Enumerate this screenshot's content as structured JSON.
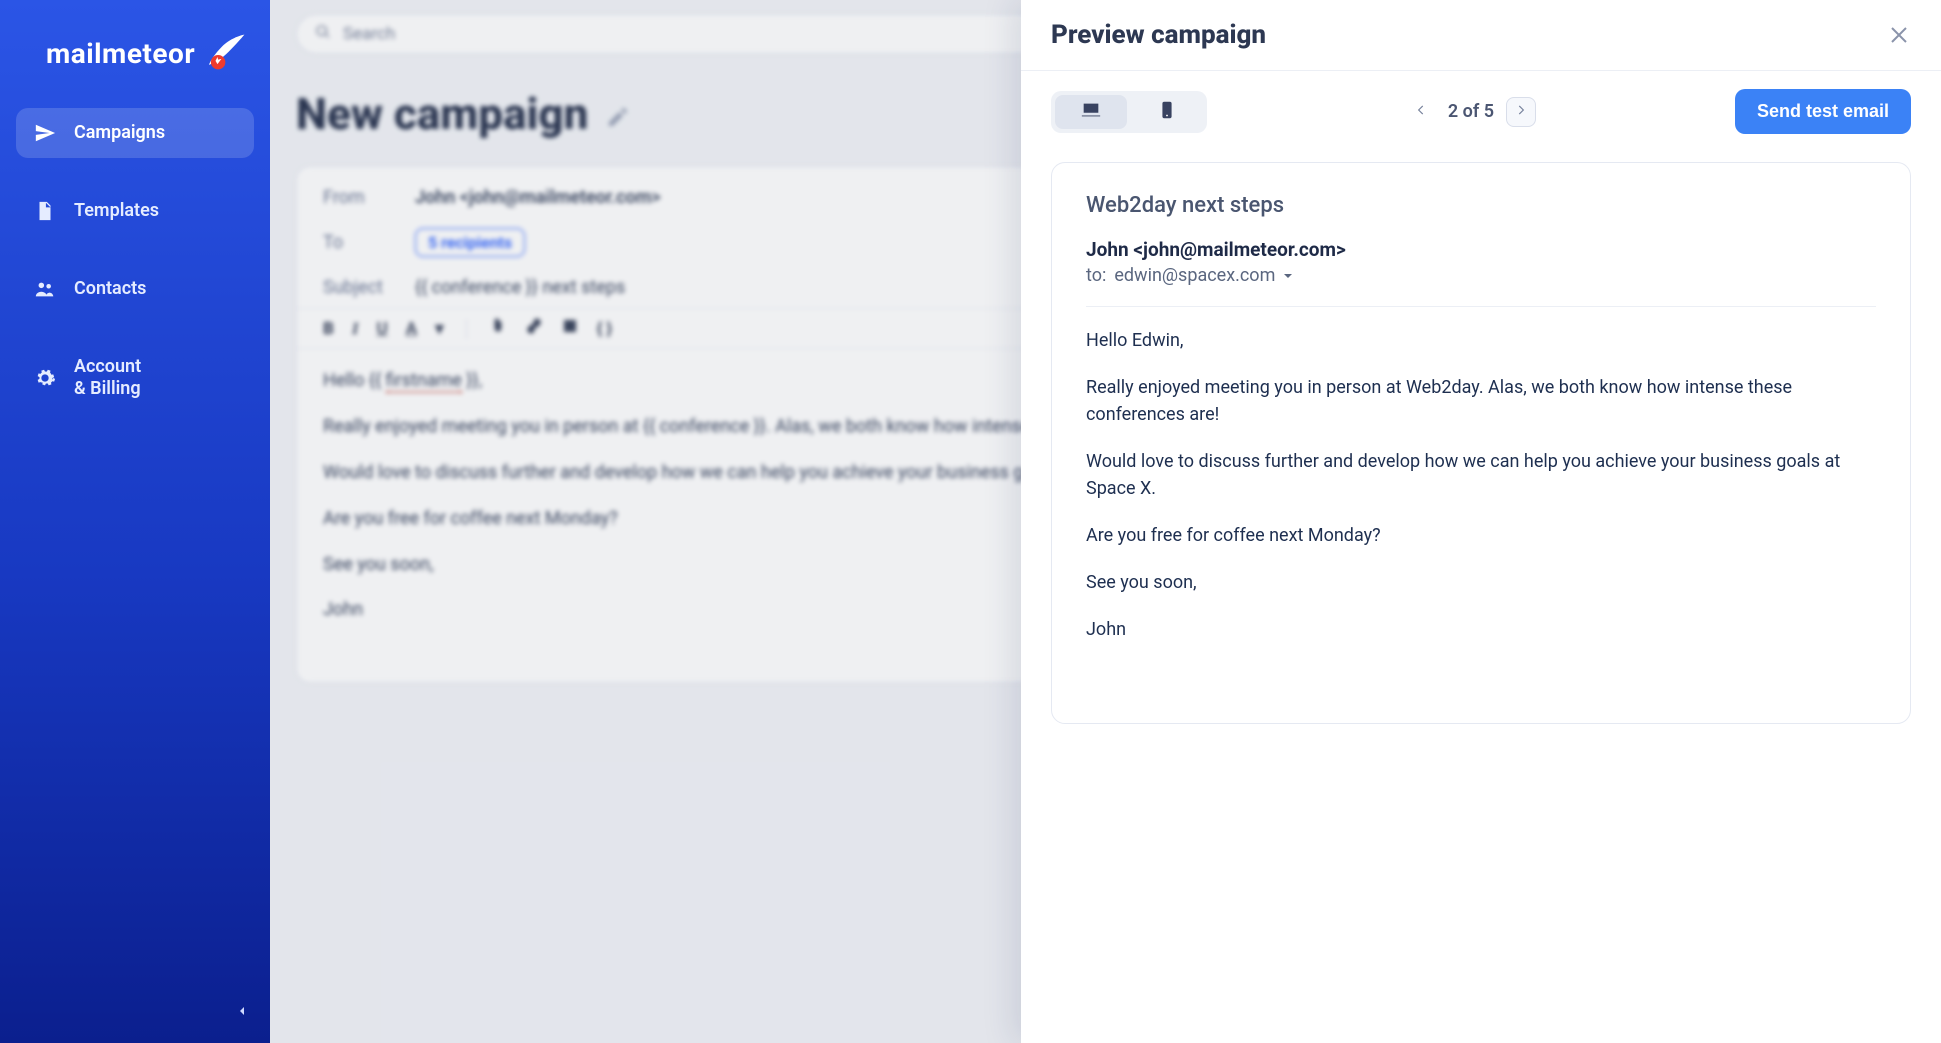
{
  "brand": {
    "name": "mailmeteor"
  },
  "search": {
    "placeholder": "Search"
  },
  "sidebar": {
    "items": [
      {
        "label": "Campaigns",
        "icon": "send-icon",
        "active": true
      },
      {
        "label": "Templates",
        "icon": "file-icon"
      },
      {
        "label": "Contacts",
        "icon": "people-icon"
      },
      {
        "label": "Account\n& Billing",
        "icon": "gear-icon"
      }
    ]
  },
  "composer": {
    "page_title": "New campaign",
    "from_label": "From",
    "from_value": "John <john@mailmeteor.com>",
    "to_label": "To",
    "recipients_chip": "5 recipients",
    "subject_label": "Subject",
    "subject_value": "{{ conference }} next steps",
    "body": {
      "greeting_pre": "Hello {{ ",
      "greeting_var": "firstname",
      "greeting_post": " }},",
      "p1": "Really enjoyed meeting you in person at {{ conference }}. Alas, we both know how intense these conferences are!",
      "p2": "Would love to discuss further and develop how we can help you achieve your business goals at {{ company }}.",
      "p3": "Are you free for coffee next Monday?",
      "p4": "See you soon,",
      "sign": "John"
    }
  },
  "preview": {
    "title": "Preview campaign",
    "pager": {
      "current": 2,
      "total": 5,
      "text": "2 of 5"
    },
    "send_test_label": "Send test email",
    "subject": "Web2day next steps",
    "from": "John <john@mailmeteor.com>",
    "to_prefix": "to: ",
    "to": "edwin@spacex.com",
    "body": {
      "p0": "Hello Edwin,",
      "p1": "Really enjoyed meeting you in person at Web2day. Alas, we both know how intense these conferences are!",
      "p2": "Would love to discuss further and develop how we can help you achieve your business goals at Space X.",
      "p3": "Are you free for coffee next Monday?",
      "p4": "See you soon,",
      "sign": "John"
    }
  }
}
